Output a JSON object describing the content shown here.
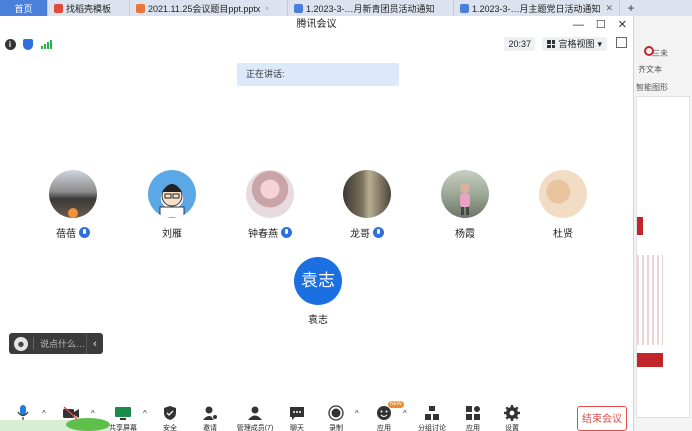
{
  "browser": {
    "tabs": [
      {
        "label": "首页",
        "type": "home"
      },
      {
        "label": "找稻壳模板",
        "color": "#e34a3a"
      },
      {
        "label": "2021.11.25会议题目ppt.pptx",
        "color": "#e8763a"
      },
      {
        "label": "1.2023-3-…月新青团员活动通知",
        "color": "#4a7fdc"
      },
      {
        "label": "1.2023-3-…月主题党日活动通知",
        "color": "#4a7fdc"
      }
    ],
    "new_tab": "+"
  },
  "background_app": {
    "items": [
      "三未",
      "齐文本",
      "智能图形"
    ]
  },
  "window": {
    "title": "腾讯会议",
    "controls": {
      "minimize": "—",
      "maximize": "☐",
      "close": "✕"
    }
  },
  "topbar": {
    "timer": "20:37",
    "view_label": "宫格视图",
    "view_caret": "▾",
    "info_glyph": "i"
  },
  "speaking_label": "正在讲话:",
  "participants": [
    {
      "name": "蓓蓓",
      "mic": true,
      "avatar": "photo-building",
      "badge": true
    },
    {
      "name": "刘雁",
      "mic": false,
      "avatar": "cartoon-man"
    },
    {
      "name": "钟春燕",
      "mic": true,
      "avatar": "cartoon-girl"
    },
    {
      "name": "龙哥",
      "mic": true,
      "avatar": "photo-path"
    },
    {
      "name": "杨霞",
      "mic": false,
      "avatar": "photo-girl"
    },
    {
      "name": "杜贤",
      "mic": false,
      "avatar": "photo-portrait"
    }
  ],
  "host": {
    "initials": "袁志",
    "name": "袁志",
    "color": "#1b6fe0"
  },
  "chat": {
    "placeholder": "说点什么…",
    "emoji_glyph": "☻",
    "collapse_glyph": "‹"
  },
  "toolbar": {
    "items": [
      {
        "label": "",
        "icon": "microphone-icon"
      },
      {
        "label": "",
        "icon": "camera-off-icon"
      },
      {
        "label": "共享屏幕",
        "icon": "screen-share-icon"
      },
      {
        "label": "安全",
        "icon": "shield-icon"
      },
      {
        "label": "邀请",
        "icon": "invite-icon"
      },
      {
        "label": "管理成员(7)",
        "icon": "members-icon"
      },
      {
        "label": "聊天",
        "icon": "chat-icon"
      },
      {
        "label": "录制",
        "icon": "record-icon"
      },
      {
        "label": "应用",
        "icon": "apps-icon",
        "tag": "NEW"
      },
      {
        "label": "分组讨论",
        "icon": "breakout-icon"
      },
      {
        "label": "应用",
        "icon": "grid-apps-icon"
      },
      {
        "label": "设置",
        "icon": "settings-icon"
      }
    ],
    "caret": "^",
    "end_label": "结束会议"
  },
  "colors": {
    "accent": "#2f6fe0",
    "danger": "#e04a4a",
    "speaking_bg": "#dce9fb"
  }
}
